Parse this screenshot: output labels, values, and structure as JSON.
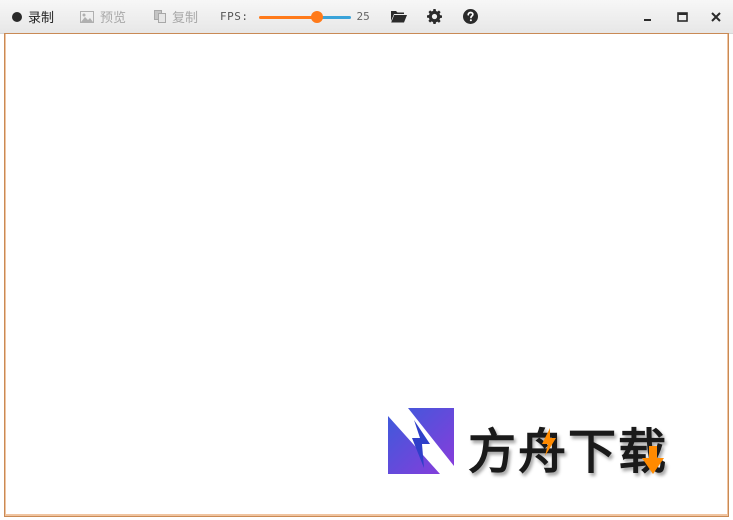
{
  "toolbar": {
    "record_label": "录制",
    "preview_label": "预览",
    "copy_label": "复制",
    "fps_label": "FPS:",
    "fps_value": "25",
    "fps_fraction": 0.63
  },
  "watermark": {
    "text": "方舟下载"
  },
  "colors": {
    "accent_orange": "#ff7a1a",
    "accent_blue": "#3aa3d9",
    "frame_border": "#c98a55",
    "logo_blue": "#3b5bdb",
    "logo_purple": "#8b3bdb"
  },
  "icons": [
    "record-dot-icon",
    "image-icon",
    "copy-icon",
    "folder-open-icon",
    "gear-icon",
    "help-icon",
    "minimize-icon",
    "maximize-icon",
    "close-icon"
  ]
}
